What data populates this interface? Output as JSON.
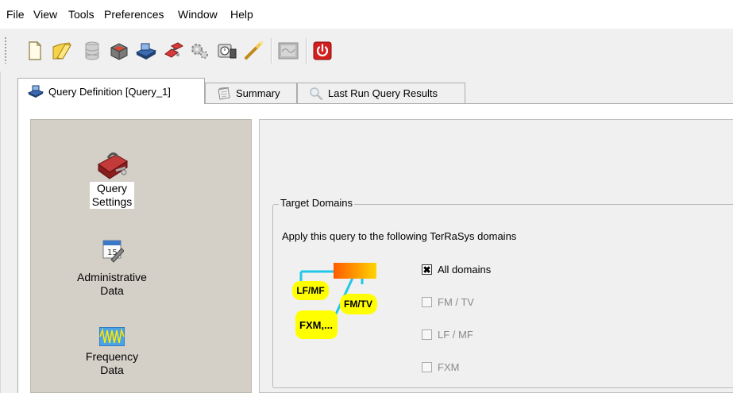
{
  "menu": [
    "File",
    "View",
    "Tools",
    "Preferences",
    "Window",
    "Help"
  ],
  "toolbar": {
    "buttons": [
      "new-document-icon",
      "open-folder-icon",
      "database-icon",
      "package-icon",
      "scanner-icon",
      "network-icon",
      "gears-icon",
      "timer-icon",
      "wand-icon",
      "map-icon",
      "power-icon"
    ],
    "accent": "#d31f1f"
  },
  "tabs": [
    {
      "label": "Query Definition [Query_1]",
      "icon": "computer-icon",
      "active": true
    },
    {
      "label": "Summary",
      "icon": "notepad-icon",
      "active": false
    },
    {
      "label": "Last Run Query Results",
      "icon": "magnifier-icon",
      "active": false
    }
  ],
  "nav": {
    "items": [
      {
        "label_line1": "Query",
        "label_line2": "Settings",
        "icon": "toolbox-icon",
        "selected": true
      },
      {
        "label_line1": "Administrative",
        "label_line2": "Data",
        "icon": "calendar-icon",
        "selected": false
      },
      {
        "label_line1": "Frequency",
        "label_line2": "Data",
        "icon": "waveform-icon",
        "selected": false
      }
    ]
  },
  "target_domains": {
    "legend": "Target Domains",
    "description": "Apply this query to the following TerRaSys domains",
    "diagram_labels": {
      "lfmf": "LF/MF",
      "fmtv": "FM/TV",
      "fxm": "FXM,..."
    },
    "options": [
      {
        "label": "All domains",
        "checked": true,
        "enabled": true
      },
      {
        "label": "FM / TV",
        "checked": false,
        "enabled": false
      },
      {
        "label": "LF / MF",
        "checked": false,
        "enabled": false
      },
      {
        "label": "FXM",
        "checked": false,
        "enabled": false
      }
    ]
  },
  "colors": {
    "yellow_badge": "#ffff00",
    "cyan_line": "#20c8e8",
    "orange_grad_start": "#ff5a00",
    "orange_grad_end": "#ffd400"
  }
}
